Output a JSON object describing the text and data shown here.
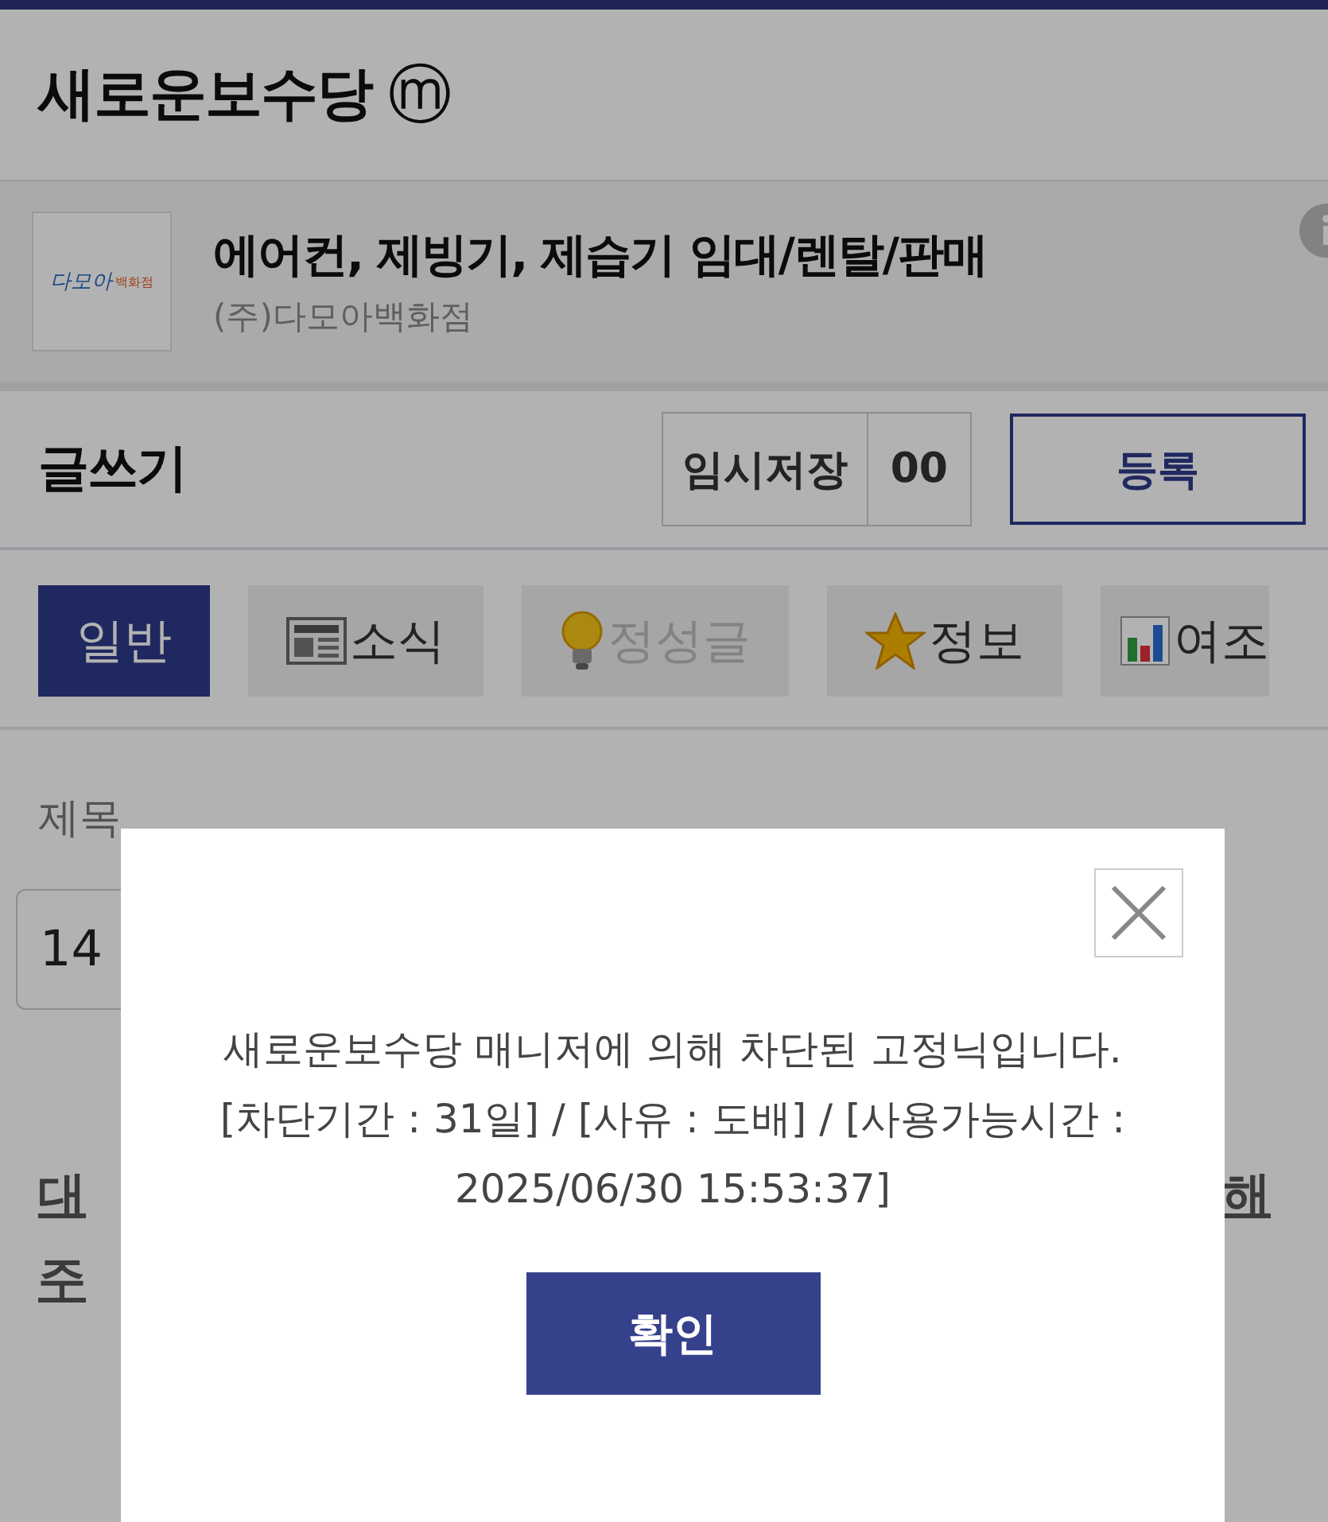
{
  "header": {
    "title": "새로운보수당",
    "badge": "ⓜ"
  },
  "shop": {
    "title": "에어컨, 제빙기, 제습기 임대/렌탈/판매",
    "company": "(주)다모아백화점",
    "logo_text": "다모아",
    "logo_sub": "백화점"
  },
  "write_bar": {
    "title": "글쓰기",
    "temp_save": "임시저장",
    "temp_count": "00",
    "submit": "등록"
  },
  "tabs": [
    {
      "label": "일반",
      "kind": "plain",
      "selected": true,
      "disabled": false
    },
    {
      "label": "소식",
      "kind": "news",
      "selected": false,
      "disabled": false
    },
    {
      "label": "정성글",
      "kind": "bulb",
      "selected": false,
      "disabled": true
    },
    {
      "label": "정보",
      "kind": "star",
      "selected": false,
      "disabled": false
    },
    {
      "label": "여조",
      "kind": "chart",
      "selected": false,
      "disabled": false
    }
  ],
  "form": {
    "subject_label": "제목",
    "subject_value": "14",
    "notice_left": [
      "대",
      "주"
    ],
    "notice_right": [
      "해"
    ]
  },
  "dialog": {
    "message_lines": [
      "새로운보수당 매니저에 의해 차단된 고정닉입니다.",
      "[차단기간 : 31일] / [사유 : 도배] / [사용가능시간 :",
      "2025/06/30 15:53:37]"
    ],
    "confirm": "확인"
  }
}
